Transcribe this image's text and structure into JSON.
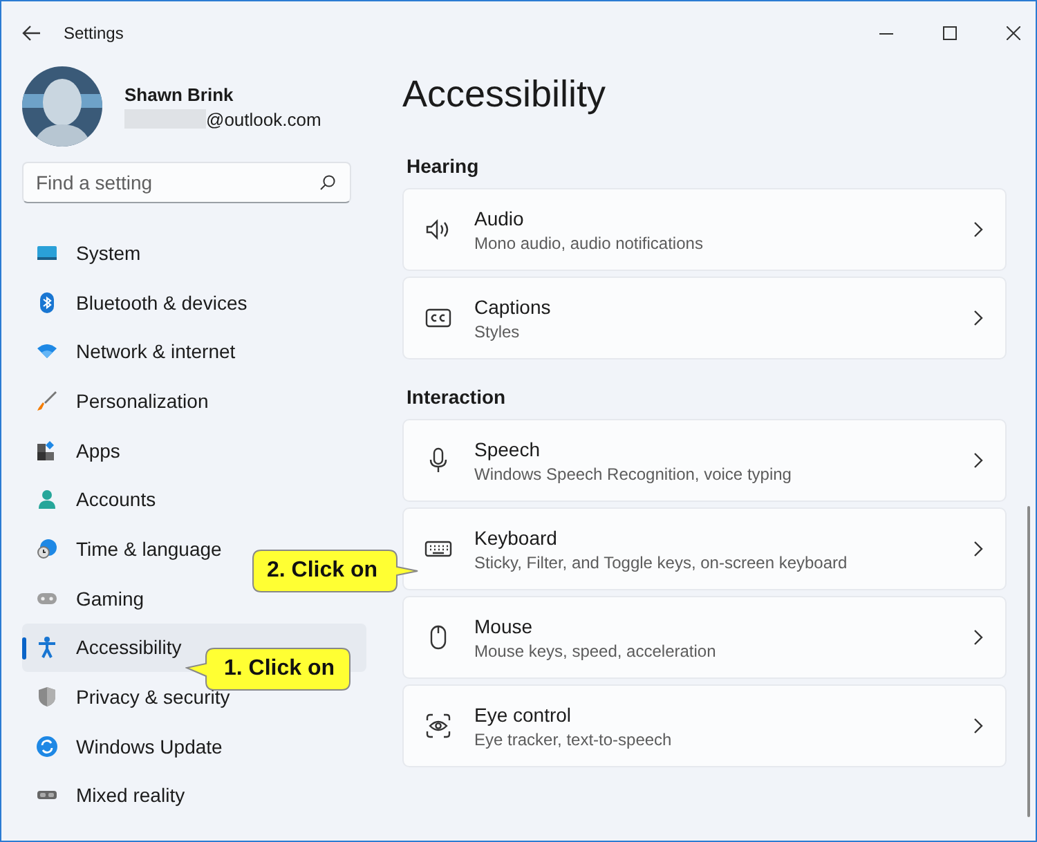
{
  "window": {
    "title": "Settings"
  },
  "account": {
    "name": "Shawn Brink",
    "email": "@outlook.com"
  },
  "search": {
    "placeholder": "Find a setting"
  },
  "nav": [
    {
      "label": "System",
      "selected": false
    },
    {
      "label": "Bluetooth & devices",
      "selected": false
    },
    {
      "label": "Network & internet",
      "selected": false
    },
    {
      "label": "Personalization",
      "selected": false
    },
    {
      "label": "Apps",
      "selected": false
    },
    {
      "label": "Accounts",
      "selected": false
    },
    {
      "label": "Time & language",
      "selected": false
    },
    {
      "label": "Gaming",
      "selected": false
    },
    {
      "label": "Accessibility",
      "selected": true
    },
    {
      "label": "Privacy & security",
      "selected": false
    },
    {
      "label": "Windows Update",
      "selected": false
    },
    {
      "label": "Mixed reality",
      "selected": false
    }
  ],
  "page_title": "Accessibility",
  "sections": [
    {
      "heading": "Hearing",
      "items": [
        {
          "title": "Audio",
          "subtitle": "Mono audio, audio notifications"
        },
        {
          "title": "Captions",
          "subtitle": "Styles"
        }
      ]
    },
    {
      "heading": "Interaction",
      "items": [
        {
          "title": "Speech",
          "subtitle": "Windows Speech Recognition, voice typing"
        },
        {
          "title": "Keyboard",
          "subtitle": "Sticky, Filter, and Toggle keys, on-screen keyboard"
        },
        {
          "title": "Mouse",
          "subtitle": "Mouse keys, speed, acceleration"
        },
        {
          "title": "Eye control",
          "subtitle": "Eye tracker, text-to-speech"
        }
      ]
    }
  ],
  "callouts": [
    {
      "text": "2. Click on"
    },
    {
      "text": "1. Click on"
    }
  ]
}
